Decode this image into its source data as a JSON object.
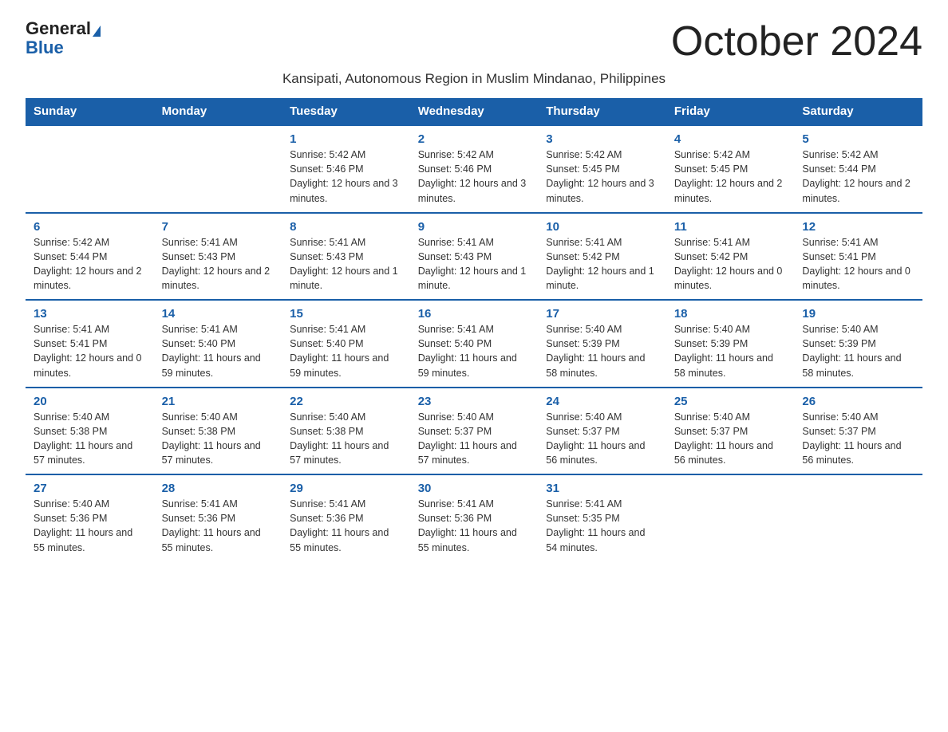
{
  "logo": {
    "general": "General",
    "blue": "Blue"
  },
  "title": "October 2024",
  "subtitle": "Kansipati, Autonomous Region in Muslim Mindanao, Philippines",
  "days_header": [
    "Sunday",
    "Monday",
    "Tuesday",
    "Wednesday",
    "Thursday",
    "Friday",
    "Saturday"
  ],
  "weeks": [
    [
      {
        "day": "",
        "info": ""
      },
      {
        "day": "",
        "info": ""
      },
      {
        "day": "1",
        "info": "Sunrise: 5:42 AM\nSunset: 5:46 PM\nDaylight: 12 hours and 3 minutes."
      },
      {
        "day": "2",
        "info": "Sunrise: 5:42 AM\nSunset: 5:46 PM\nDaylight: 12 hours and 3 minutes."
      },
      {
        "day": "3",
        "info": "Sunrise: 5:42 AM\nSunset: 5:45 PM\nDaylight: 12 hours and 3 minutes."
      },
      {
        "day": "4",
        "info": "Sunrise: 5:42 AM\nSunset: 5:45 PM\nDaylight: 12 hours and 2 minutes."
      },
      {
        "day": "5",
        "info": "Sunrise: 5:42 AM\nSunset: 5:44 PM\nDaylight: 12 hours and 2 minutes."
      }
    ],
    [
      {
        "day": "6",
        "info": "Sunrise: 5:42 AM\nSunset: 5:44 PM\nDaylight: 12 hours and 2 minutes."
      },
      {
        "day": "7",
        "info": "Sunrise: 5:41 AM\nSunset: 5:43 PM\nDaylight: 12 hours and 2 minutes."
      },
      {
        "day": "8",
        "info": "Sunrise: 5:41 AM\nSunset: 5:43 PM\nDaylight: 12 hours and 1 minute."
      },
      {
        "day": "9",
        "info": "Sunrise: 5:41 AM\nSunset: 5:43 PM\nDaylight: 12 hours and 1 minute."
      },
      {
        "day": "10",
        "info": "Sunrise: 5:41 AM\nSunset: 5:42 PM\nDaylight: 12 hours and 1 minute."
      },
      {
        "day": "11",
        "info": "Sunrise: 5:41 AM\nSunset: 5:42 PM\nDaylight: 12 hours and 0 minutes."
      },
      {
        "day": "12",
        "info": "Sunrise: 5:41 AM\nSunset: 5:41 PM\nDaylight: 12 hours and 0 minutes."
      }
    ],
    [
      {
        "day": "13",
        "info": "Sunrise: 5:41 AM\nSunset: 5:41 PM\nDaylight: 12 hours and 0 minutes."
      },
      {
        "day": "14",
        "info": "Sunrise: 5:41 AM\nSunset: 5:40 PM\nDaylight: 11 hours and 59 minutes."
      },
      {
        "day": "15",
        "info": "Sunrise: 5:41 AM\nSunset: 5:40 PM\nDaylight: 11 hours and 59 minutes."
      },
      {
        "day": "16",
        "info": "Sunrise: 5:41 AM\nSunset: 5:40 PM\nDaylight: 11 hours and 59 minutes."
      },
      {
        "day": "17",
        "info": "Sunrise: 5:40 AM\nSunset: 5:39 PM\nDaylight: 11 hours and 58 minutes."
      },
      {
        "day": "18",
        "info": "Sunrise: 5:40 AM\nSunset: 5:39 PM\nDaylight: 11 hours and 58 minutes."
      },
      {
        "day": "19",
        "info": "Sunrise: 5:40 AM\nSunset: 5:39 PM\nDaylight: 11 hours and 58 minutes."
      }
    ],
    [
      {
        "day": "20",
        "info": "Sunrise: 5:40 AM\nSunset: 5:38 PM\nDaylight: 11 hours and 57 minutes."
      },
      {
        "day": "21",
        "info": "Sunrise: 5:40 AM\nSunset: 5:38 PM\nDaylight: 11 hours and 57 minutes."
      },
      {
        "day": "22",
        "info": "Sunrise: 5:40 AM\nSunset: 5:38 PM\nDaylight: 11 hours and 57 minutes."
      },
      {
        "day": "23",
        "info": "Sunrise: 5:40 AM\nSunset: 5:37 PM\nDaylight: 11 hours and 57 minutes."
      },
      {
        "day": "24",
        "info": "Sunrise: 5:40 AM\nSunset: 5:37 PM\nDaylight: 11 hours and 56 minutes."
      },
      {
        "day": "25",
        "info": "Sunrise: 5:40 AM\nSunset: 5:37 PM\nDaylight: 11 hours and 56 minutes."
      },
      {
        "day": "26",
        "info": "Sunrise: 5:40 AM\nSunset: 5:37 PM\nDaylight: 11 hours and 56 minutes."
      }
    ],
    [
      {
        "day": "27",
        "info": "Sunrise: 5:40 AM\nSunset: 5:36 PM\nDaylight: 11 hours and 55 minutes."
      },
      {
        "day": "28",
        "info": "Sunrise: 5:41 AM\nSunset: 5:36 PM\nDaylight: 11 hours and 55 minutes."
      },
      {
        "day": "29",
        "info": "Sunrise: 5:41 AM\nSunset: 5:36 PM\nDaylight: 11 hours and 55 minutes."
      },
      {
        "day": "30",
        "info": "Sunrise: 5:41 AM\nSunset: 5:36 PM\nDaylight: 11 hours and 55 minutes."
      },
      {
        "day": "31",
        "info": "Sunrise: 5:41 AM\nSunset: 5:35 PM\nDaylight: 11 hours and 54 minutes."
      },
      {
        "day": "",
        "info": ""
      },
      {
        "day": "",
        "info": ""
      }
    ]
  ]
}
